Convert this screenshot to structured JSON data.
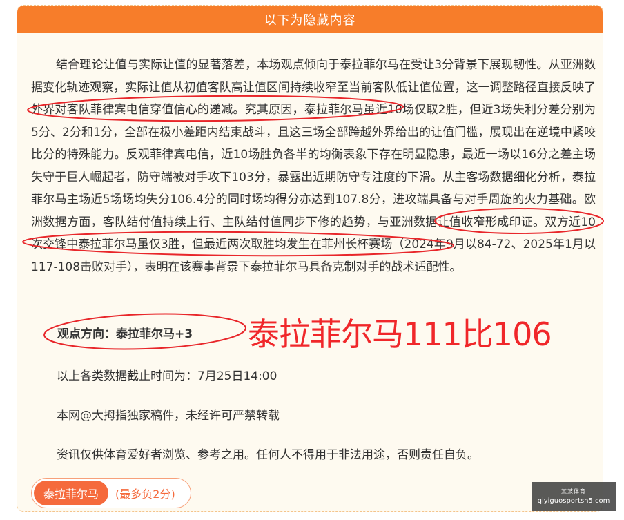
{
  "panel": {
    "header": "以下为隐藏内容"
  },
  "article": {
    "paragraph": "结合理论让值与实际让值的显著落差，本场观点倾向于泰拉菲尔马在受让3分背景下展现韧性。从亚洲数据变化轨迹观察，实际让值从初值客队高让值区间持续收窄至当前客队低让值位置，这一调整路径直接反映了外界对客队菲律宾电信穿值信心的递减。究其原因，泰拉菲尔马虽近10场仅取2胜，但近3场失利分差分别为5分、2分和1分，全部在极小差距内结束战斗，且这三场全部跨越外界给出的让值门槛，展现出在逆境中紧咬比分的特殊能力。反观菲律宾电信，近10场胜负各半的均衡表象下存在明显隐患，最近一场以16分之差主场失守于巨人崛起者，防守端被对手攻下103分，暴露出近期防守专注度的下滑。从主客场数据细化分析，泰拉菲尔马主场近5场场均失分106.4分的同时场均得分亦达到107.8分，进攻端具备与对手周旋的火力基础。欧洲数据方面，客队结付值持续上行、主队结付值同步下修的趋势，与亚洲数据让值收窄形成印证。双方近10次交锋中泰拉菲尔马虽仅3胜，但最近两次取胜均发生在菲州长杯赛场（2024年9月以84-72、2025年1月以117-108击败对手），表明在该赛事背景下泰拉菲尔马具备克制对手的战术适配性。"
  },
  "viewpoint": "观点方向：泰拉菲尔马+3",
  "handwritten_score": "泰拉菲尔马111比106",
  "notes": {
    "cutoff": "以上各类数据截止时间为：7月25日14:00",
    "copyright": "本网@大拇指独家稿件，未经许可严禁转载",
    "disclaimer": "资讯仅供体育爱好者浏览、参考之用。任何人不得用于非法用途，否则责任自负。"
  },
  "tag": {
    "name": "泰拉菲尔马",
    "hint": "(最多负2分)"
  },
  "watermark": {
    "line1": "某某体育",
    "line2": "qiyiguosportsh5.com"
  },
  "colors": {
    "header_bg": "#f77d2a",
    "panel_bg": "#fefaf0",
    "annotation_red": "#e8262a",
    "tag_orange": "#f56a3c"
  }
}
